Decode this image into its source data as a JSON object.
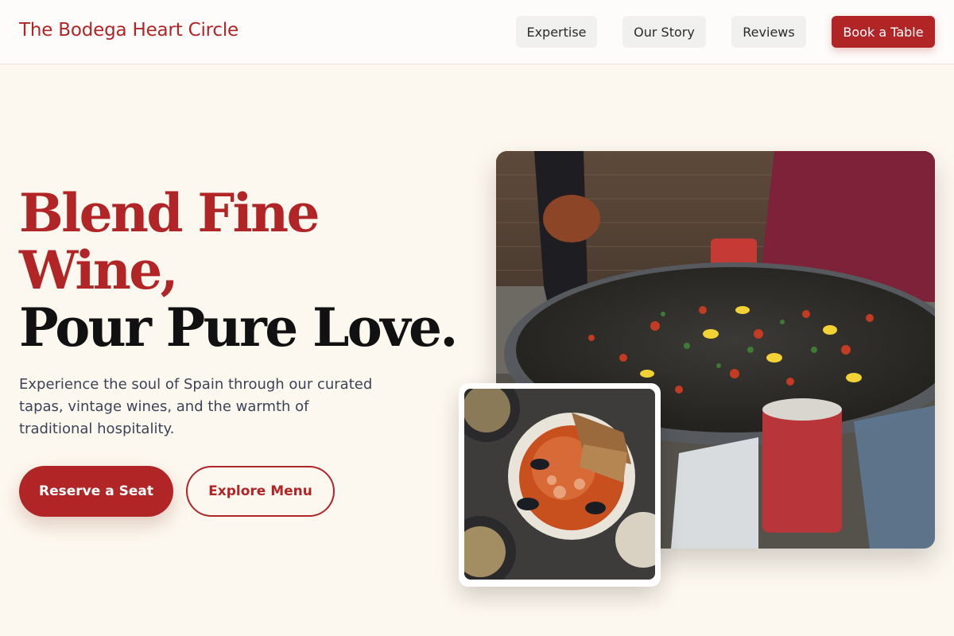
{
  "header": {
    "brand": "The Bodega Heart Circle",
    "nav": {
      "expertise": "Expertise",
      "our_story": "Our Story",
      "reviews": "Reviews",
      "book": "Book a Table"
    }
  },
  "hero": {
    "headline_line1": "Blend Fine",
    "headline_line2": "Wine,",
    "headline_line3": "Pour Pure Love.",
    "lead": "Experience the soul of Spain through our curated tapas, vintage wines, and the warmth of traditional hospitality.",
    "primary_cta": "Reserve a Seat",
    "secondary_cta": "Explore Menu"
  },
  "colors": {
    "accent": "#b22527",
    "background": "#fdf8ef",
    "text_dark": "#111111",
    "text_muted": "#3b4357"
  },
  "images": {
    "main_photo": "paella-street-market-photo",
    "small_photo": "seafood-stew-bowl-photo"
  }
}
